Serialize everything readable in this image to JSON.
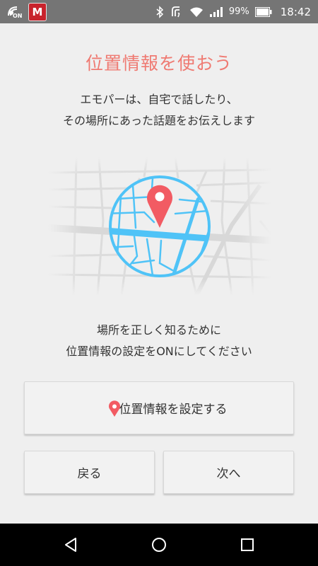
{
  "status_bar": {
    "on_label": "ON",
    "mcafee_label": "M",
    "battery": "99%",
    "time": "18:42"
  },
  "screen": {
    "title": "位置情報を使おう",
    "intro_line1": "エモパーは、自宅で話したり、",
    "intro_line2": "その場所にあった話題をお伝えします",
    "hint_line1": "場所を正しく知るために",
    "hint_line2": "位置情報の設定をONにしてください"
  },
  "buttons": {
    "location_setting": "位置情報を設定する",
    "back": "戻る",
    "next": "次へ"
  },
  "colors": {
    "accent": "#ef7a72",
    "pin": "#f25b63",
    "map_blue": "#4fc3f7",
    "status_bar": "#757575",
    "nav_bar": "#000000"
  },
  "icons": {
    "status": [
      "on-icon",
      "mcafee-icon",
      "bluetooth-icon",
      "nfc-icon",
      "wifi-icon",
      "signal-icon",
      "battery-icon"
    ],
    "nav": [
      "back-icon",
      "home-icon",
      "recent-apps-icon"
    ],
    "button": "location-pin-icon"
  }
}
